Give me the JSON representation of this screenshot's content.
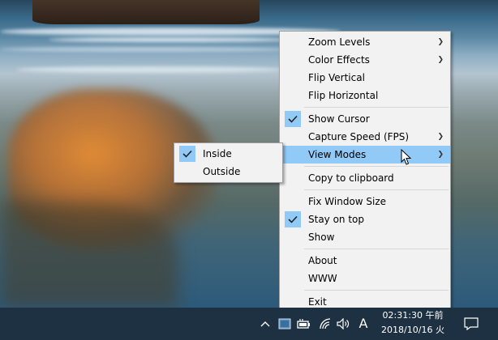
{
  "main_menu": {
    "items": [
      {
        "label": "Zoom Levels",
        "submenu": true
      },
      {
        "label": "Color Effects",
        "submenu": true
      },
      {
        "label": "Flip Vertical"
      },
      {
        "label": "Flip Horizontal"
      },
      {
        "label": "Show Cursor",
        "checked": true
      },
      {
        "label": "Capture Speed (FPS)",
        "submenu": true
      },
      {
        "label": "View Modes",
        "submenu": true,
        "highlighted": true
      },
      {
        "label": "Copy to clipboard"
      },
      {
        "label": "Fix Window Size"
      },
      {
        "label": "Stay on top",
        "checked": true
      },
      {
        "label": "Show"
      },
      {
        "label": "About"
      },
      {
        "label": "WWW"
      },
      {
        "label": "Exit"
      }
    ]
  },
  "sub_menu": {
    "items": [
      {
        "label": "Inside",
        "checked": true
      },
      {
        "label": "Outside"
      }
    ]
  },
  "taskbar": {
    "ime_label": "A",
    "time": "02:31:30 午前",
    "date": "2018/10/16 火"
  },
  "icons": [
    "chevron-up-icon",
    "app-tray-icon",
    "battery-icon",
    "wifi-icon",
    "speaker-icon",
    "notification-icon",
    "check-icon",
    "submenu-arrow-icon",
    "mouse-cursor-icon"
  ],
  "colors": {
    "highlight": "#91c9f7",
    "menu_bg": "#f2f2f2",
    "taskbar": "#1d3142"
  }
}
